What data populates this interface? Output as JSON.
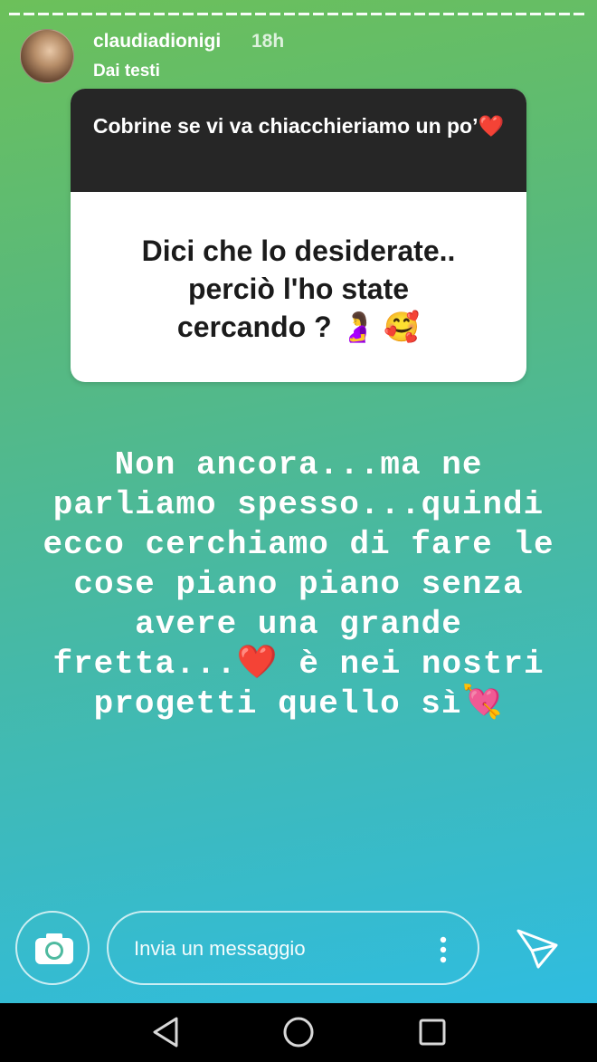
{
  "story": {
    "username": "claudiadionigi",
    "time": "18h",
    "subtitle": "Dai testi"
  },
  "question": {
    "header": "Cobrine se vi va chiacchieriamo un po’",
    "header_emoji": "❤️",
    "body_lines": [
      "Dici che lo desiderate..",
      "perciò l'ho state",
      "cercando ?"
    ],
    "body_emojis": "🤰 🥰"
  },
  "answer": {
    "lines": [
      "Non ancora...ma ne",
      "parliamo spesso...quindi",
      "ecco cerchiamo di fare le",
      "cose piano piano senza",
      "avere una grande",
      "fretta...",
      "è nei nostri",
      "progetti quello sì"
    ],
    "heart_emoji": "❤️",
    "end_emoji": "💘"
  },
  "reply_bar": {
    "placeholder": "Invia un messaggio",
    "camera_icon": "camera-icon",
    "more_icon": "more-vertical-icon",
    "send_icon": "send-icon"
  },
  "colors": {
    "gradient_top": "#6cc05a",
    "gradient_bottom": "#2fbce0",
    "question_header_bg": "#262626",
    "navbar_bg": "#000000"
  }
}
